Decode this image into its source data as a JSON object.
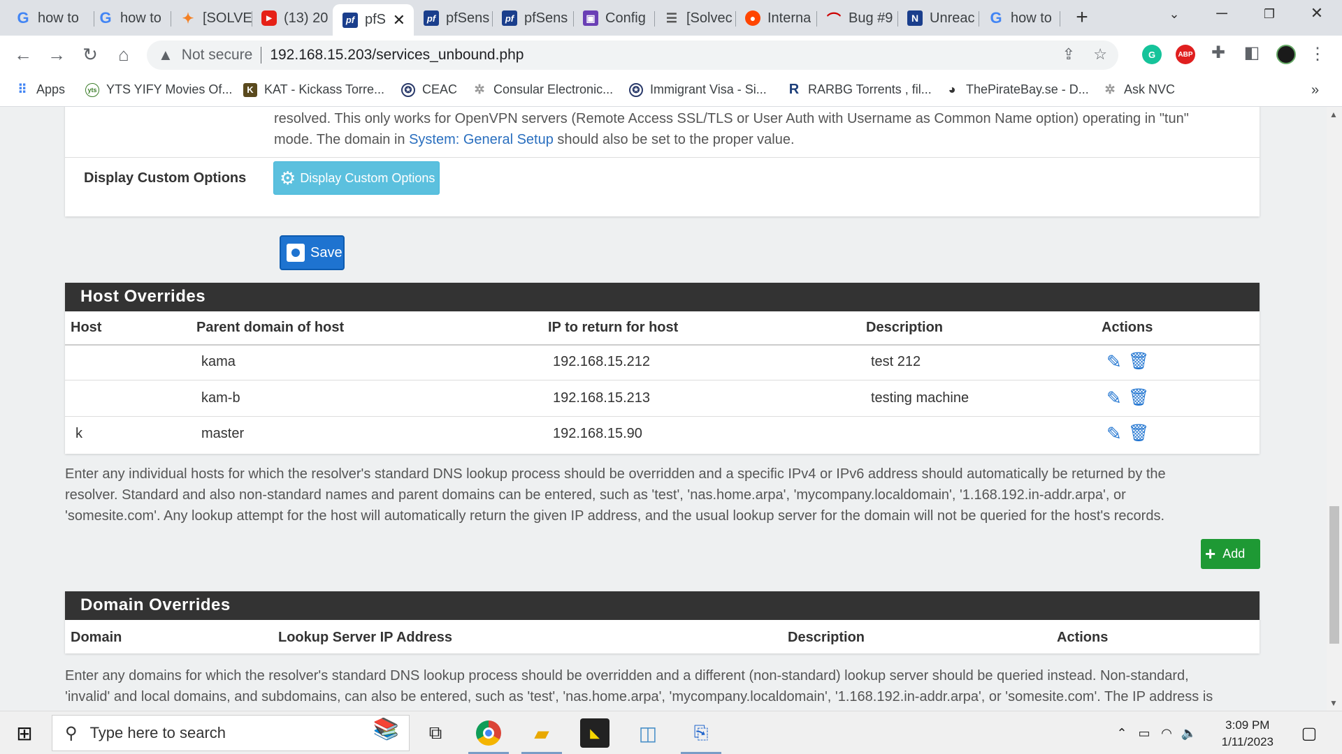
{
  "browser": {
    "tabs": [
      {
        "label": "how to",
        "icon": "google"
      },
      {
        "label": "how to",
        "icon": "google"
      },
      {
        "label": "[SOLVE",
        "icon": "stackoverflow"
      },
      {
        "label": "(13) 20",
        "icon": "youtube"
      },
      {
        "label": "pfS",
        "icon": "pfsense",
        "active": true
      },
      {
        "label": "pfSens",
        "icon": "pfsense"
      },
      {
        "label": "pfSens",
        "icon": "pfsense"
      },
      {
        "label": "Config",
        "icon": "config"
      },
      {
        "label": "[Solvec",
        "icon": "doc"
      },
      {
        "label": "Interna",
        "icon": "reddit"
      },
      {
        "label": "Bug #9",
        "icon": "redmine"
      },
      {
        "label": "Unreac",
        "icon": "netgate"
      },
      {
        "label": "how to",
        "icon": "google"
      }
    ],
    "address": {
      "security": "Not secure",
      "url": "192.168.15.203/services_unbound.php"
    },
    "bookmarks": [
      {
        "label": "Apps",
        "icon": "apps-grid"
      },
      {
        "label": "YTS YIFY Movies Of...",
        "icon": "yts"
      },
      {
        "label": "KAT - Kickass Torre...",
        "icon": "kat"
      },
      {
        "label": "CEAC",
        "icon": "seal"
      },
      {
        "label": "Consular Electronic...",
        "icon": "gear"
      },
      {
        "label": "Immigrant Visa - Si...",
        "icon": "seal"
      },
      {
        "label": "RARBG Torrents , fil...",
        "icon": "rarbg"
      },
      {
        "label": "ThePirateBay.se - D...",
        "icon": "globe"
      },
      {
        "label": "Ask NVC",
        "icon": "gear"
      }
    ],
    "more_bookmarks": "»"
  },
  "page": {
    "top_text_1": "resolved. This only works for OpenVPN servers (Remote Access SSL/TLS or User Auth with Username as Common Name option) operating in \"tun\"",
    "top_text_2a": "mode. The domain in ",
    "top_text_link": "System: General Setup",
    "top_text_2b": " should also be set to the proper value.",
    "custom_options_label": "Display Custom Options",
    "custom_options_button": "Display Custom Options",
    "save_button": "Save",
    "host_overrides": {
      "title": "Host Overrides",
      "columns": [
        "Host",
        "Parent domain of host",
        "IP to return for host",
        "Description",
        "Actions"
      ],
      "rows": [
        {
          "host": "",
          "domain": "kama",
          "ip": "192.168.15.212",
          "description": "test 212"
        },
        {
          "host": "",
          "domain": "kam-b",
          "ip": "192.168.15.213",
          "description": "testing machine"
        },
        {
          "host": "k",
          "domain": "master",
          "ip": "192.168.15.90",
          "description": ""
        }
      ],
      "help_lines": [
        "Enter any individual hosts for which the resolver's standard DNS lookup process should be overridden and a specific IPv4 or IPv6 address should automatically be returned by the",
        "resolver. Standard and also non-standard names and parent domains can be entered, such as 'test', 'nas.home.arpa', 'mycompany.localdomain', '1.168.192.in-addr.arpa', or",
        "'somesite.com'. Any lookup attempt for the host will automatically return the given IP address, and the usual lookup server for the domain will not be queried for the host's records."
      ],
      "add_button": "Add"
    },
    "domain_overrides": {
      "title": "Domain Overrides",
      "columns": [
        "Domain",
        "Lookup Server IP Address",
        "Description",
        "Actions"
      ],
      "help_lines": [
        "Enter any domains for which the resolver's standard DNS lookup process should be overridden and a different (non-standard) lookup server should be queried instead. Non-standard,",
        "'invalid' and local domains, and subdomains, can also be entered, such as 'test', 'nas.home.arpa', 'mycompany.localdomain', '1.168.192.in-addr.arpa', or 'somesite.com'. The IP address is"
      ]
    }
  },
  "taskbar": {
    "search_placeholder": "Type here to search",
    "time": "3:09 PM",
    "date": "1/11/2023"
  },
  "colors": {
    "panel_header": "#333333",
    "link": "#2a6fbf",
    "info_button": "#5bc0de",
    "primary_button": "#1e73d0",
    "success_button": "#1e9934",
    "action_icons": "#1e73d0"
  }
}
